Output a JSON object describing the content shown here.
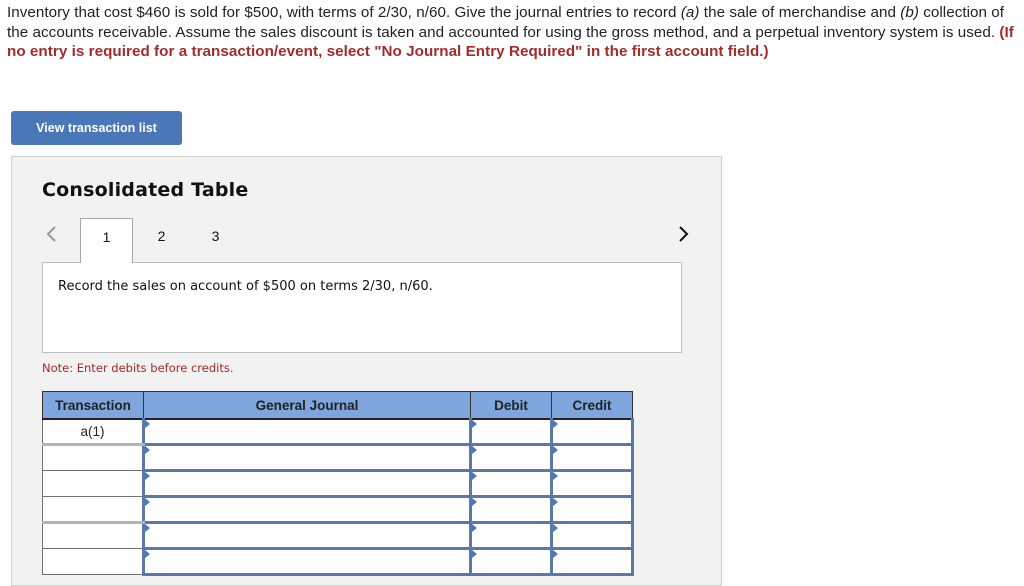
{
  "question": {
    "part1": "Inventory that cost $460 is sold for $500, with terms of 2/30, n/60. Give the journal entries to record ",
    "label_a": "(a)",
    "part2": " the sale of merchandise and ",
    "label_b": "(b)",
    "part3": " collection of the accounts receivable. Assume the sales discount is taken and accounted for using the gross method, and a perpetual inventory system is used. ",
    "warning": "(If no entry is required for a transaction/event, select \"No Journal Entry Required\" in the first account field.)"
  },
  "view_button": {
    "label": "View transaction list"
  },
  "panel": {
    "title": "Consolidated Table",
    "prev_icon": "chevron-left-icon",
    "next_icon": "chevron-right-icon",
    "tabs": [
      {
        "label": "1",
        "active": true
      },
      {
        "label": "2",
        "active": false
      },
      {
        "label": "3",
        "active": false
      }
    ],
    "instruction": "Record the sales on account of $500 on terms 2/30, n/60.",
    "note": "Note: Enter debits before credits."
  },
  "journal": {
    "headers": {
      "transaction": "Transaction",
      "general_journal": "General Journal",
      "debit": "Debit",
      "credit": "Credit"
    },
    "rows": [
      {
        "transaction": "a(1)",
        "account": "",
        "debit": "",
        "credit": ""
      },
      {
        "transaction": "",
        "account": "",
        "debit": "",
        "credit": ""
      },
      {
        "transaction": "",
        "account": "",
        "debit": "",
        "credit": ""
      },
      {
        "transaction": "",
        "account": "",
        "debit": "",
        "credit": ""
      },
      {
        "transaction": "",
        "account": "",
        "debit": "",
        "credit": ""
      },
      {
        "transaction": "",
        "account": "",
        "debit": "",
        "credit": ""
      }
    ]
  }
}
